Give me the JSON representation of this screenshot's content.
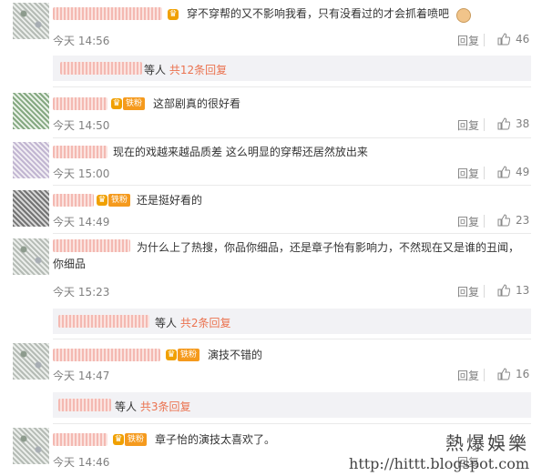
{
  "comments": [
    {
      "text": "穿不穿帮的又不影响我看，只有没看过的才会抓着喷吧",
      "time": "今天 14:56",
      "reply": "回复",
      "likes": "46"
    },
    {
      "badge": "铁粉",
      "text": "这部剧真的很好看",
      "time": "今天 14:50",
      "reply": "回复",
      "likes": "38"
    },
    {
      "text": "现在的戏越来越品质差 这么明显的穿帮还居然放出来",
      "time": "今天 15:00",
      "reply": "回复",
      "likes": "49"
    },
    {
      "badge": "铁粉",
      "text": "还是挺好看的",
      "time": "今天 14:49",
      "reply": "回复",
      "likes": "23"
    },
    {
      "text": "为什么上了热搜，你品你细品，还是章子怡有影响力，不然现在又是谁的丑闻，你细品",
      "time": "今天 15:23",
      "reply": "回复",
      "likes": "13"
    },
    {
      "badge": "铁粉",
      "text": "演技不错的",
      "time": "今天 14:47",
      "reply": "回复",
      "likes": "16"
    },
    {
      "badge": "铁粉",
      "text": "章子怡的演技太喜欢了。",
      "time": "今天 14:46",
      "reply": "回复",
      "likes": ""
    }
  ],
  "subreplies": [
    {
      "prefix": "等人",
      "link": "共12条回复"
    },
    {
      "prefix": "等人",
      "link": "共2条回复"
    },
    {
      "prefix": "等人",
      "link": "共3条回复"
    }
  ],
  "watermark": {
    "line1": "熱爆娛樂",
    "line2": "http://hittt.blogspot.com"
  },
  "colors": {
    "link": "#eb7350",
    "muted": "#808080",
    "badge": "#f59a1d"
  }
}
